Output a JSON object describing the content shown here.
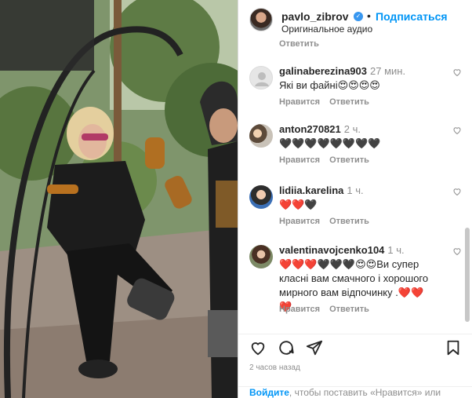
{
  "header": {
    "username": "pavlo_zibrov",
    "separator": "•",
    "follow_label": "Подписаться",
    "audio_label": "Оригинальное аудио",
    "verified_symbol": "✓"
  },
  "comments": {
    "cut_reply_label": "Ответить",
    "like_label": "Нравится",
    "reply_label": "Ответить",
    "items": [
      {
        "user": "galinaberezina903",
        "time": "27 мин.",
        "text": "Які ви файні😍😍😍😍"
      },
      {
        "user": "anton270821",
        "time": "2 ч.",
        "text": "🖤🖤🖤🖤🖤🖤🖤🖤"
      },
      {
        "user": "lidiia.karelina",
        "time": "1 ч.",
        "text": "❤️❤️🖤"
      },
      {
        "user": "valentinavojcenko104",
        "time": "1 ч.",
        "text": "❤️❤️❤️🖤🖤🖤😍😍Ви супер класні вам смачного і хорошого мирного вам відпочинку .❤️❤️❤️"
      }
    ]
  },
  "footer": {
    "time_ago": "2 часов назад",
    "login_link": "Войдите",
    "login_text": ", чтобы поставить «Нравится» или"
  },
  "colors": {
    "accent": "#0095f6",
    "muted": "#8e8e8e",
    "text": "#262626"
  },
  "icons": {
    "like": "heart-icon",
    "comment": "comment-icon",
    "share": "share-icon",
    "save": "bookmark-icon"
  }
}
